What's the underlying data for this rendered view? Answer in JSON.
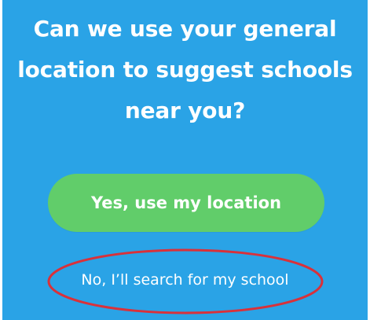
{
  "prompt": {
    "line1": "Can we use your general",
    "line2": "location to suggest schools",
    "line3": "near you?"
  },
  "buttons": {
    "accept_label": "Yes, use my location",
    "decline_label": "No, I’ll search for my school"
  },
  "colors": {
    "background": "#2aa3e6",
    "accept_button": "#61cd6a",
    "annotation": "#d9313a"
  }
}
